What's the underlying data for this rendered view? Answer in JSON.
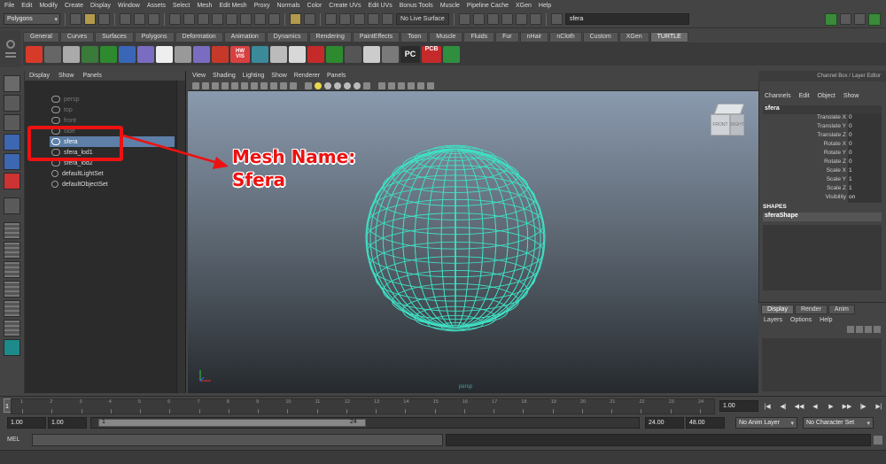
{
  "menubar": [
    "File",
    "Edit",
    "Modify",
    "Create",
    "Display",
    "Window",
    "Assets",
    "Select",
    "Mesh",
    "Edit Mesh",
    "Proxy",
    "Normals",
    "Color",
    "Create UVs",
    "Edit UVs",
    "Bonus Tools",
    "Muscle",
    "Pipeline Cache",
    "XGen",
    "Help"
  ],
  "statusline": {
    "mode": "Polygons",
    "live_surface": "No Live Surface",
    "search_value": "sfera"
  },
  "shelf_tabs": [
    "General",
    "Curves",
    "Surfaces",
    "Polygons",
    "Deformation",
    "Animation",
    "Dynamics",
    "Rendering",
    "PaintEffects",
    "Toon",
    "Muscle",
    "Fluids",
    "Fur",
    "nHair",
    "nCloth",
    "Custom",
    "XGen",
    "TURTLE"
  ],
  "shelf_active_tab": "TURTLE",
  "shelf_icon_texts": {
    "vis_top": "HW",
    "vis": "VIS",
    "pc": "PC",
    "pcb": "PCB"
  },
  "shelf_icon_colors": [
    "#d83a2a",
    "#666",
    "#aaa",
    "#3a7a3a",
    "#2e8a2e",
    "#3a66b8",
    "#7a6cc0",
    "#eee",
    "#999",
    "#7a6cc0",
    "#c6382a",
    "#d84040",
    "#3a8a9a",
    "#bbb",
    "#d8d8d8",
    "#c42a2a",
    "#2e8a2e",
    "#555",
    "#ccc",
    "#7a7a7a",
    "#2b2b2b",
    "#c42a2a",
    "#2f8f3f"
  ],
  "outliner": {
    "menu": [
      "Display",
      "Show",
      "Panels"
    ],
    "items": [
      {
        "label": "persp",
        "dim": true,
        "selected": false
      },
      {
        "label": "top",
        "dim": true,
        "selected": false
      },
      {
        "label": "front",
        "dim": true,
        "selected": false
      },
      {
        "label": "side",
        "dim": true,
        "selected": false
      },
      {
        "label": "sfera",
        "dim": false,
        "selected": true
      },
      {
        "label": "sfera_lod1",
        "dim": false,
        "selected": false
      },
      {
        "label": "sfera_lod2",
        "dim": false,
        "selected": false
      },
      {
        "label": "defaultLightSet",
        "dim": false,
        "selected": false
      },
      {
        "label": "defaultObjectSet",
        "dim": false,
        "selected": false
      }
    ]
  },
  "viewport": {
    "menu": [
      "View",
      "Shading",
      "Lighting",
      "Show",
      "Renderer",
      "Panels"
    ],
    "camera_label": "persp",
    "viewcube_labels": {
      "front": "FRONT",
      "right": "RIGHT"
    },
    "bg_top": "#8a9aae",
    "bg_bottom": "#262a2e",
    "wire_color": "#3fe0c4"
  },
  "annotation": {
    "line1": "Mesh Name:",
    "line2": "Sfera",
    "color": "#e11111"
  },
  "channel_box": {
    "title": "Channel Box / Layer Editor",
    "menu": [
      "Channels",
      "Edit",
      "Object",
      "Show"
    ],
    "object_name": "sfera",
    "attributes": [
      {
        "name": "Translate X",
        "value": "0"
      },
      {
        "name": "Translate Y",
        "value": "0"
      },
      {
        "name": "Translate Z",
        "value": "0"
      },
      {
        "name": "Rotate X",
        "value": "0"
      },
      {
        "name": "Rotate Y",
        "value": "0"
      },
      {
        "name": "Rotate Z",
        "value": "0"
      },
      {
        "name": "Scale X",
        "value": "1"
      },
      {
        "name": "Scale Y",
        "value": "1"
      },
      {
        "name": "Scale Z",
        "value": "1"
      },
      {
        "name": "Visibility",
        "value": "on"
      }
    ],
    "shapes_header": "SHAPES",
    "shape_name": "sferaShape"
  },
  "layer_editor": {
    "tabs": [
      "Display",
      "Render",
      "Anim"
    ],
    "active_tab": "Display",
    "menu": [
      "Layers",
      "Options",
      "Help"
    ]
  },
  "timeline": {
    "current_frame": "1",
    "ticks": [
      "1",
      "2",
      "3",
      "4",
      "5",
      "6",
      "7",
      "8",
      "9",
      "10",
      "11",
      "12",
      "13",
      "14",
      "15",
      "16",
      "17",
      "18",
      "19",
      "20",
      "21",
      "22",
      "23",
      "24"
    ],
    "current_time": "1.00",
    "playback_buttons": [
      "|◀",
      "◀|",
      "◀◀",
      "◀",
      "▶",
      "▶▶",
      "|▶",
      "▶|"
    ]
  },
  "range": {
    "start_anim": "1.00",
    "start_play": "1.00",
    "slider_start": "1",
    "slider_end": "24",
    "end_play": "24.00",
    "end_anim": "48.00",
    "anim_layer": "No Anim Layer",
    "char_set": "No Character Set"
  },
  "command_line": {
    "label": "MEL"
  }
}
